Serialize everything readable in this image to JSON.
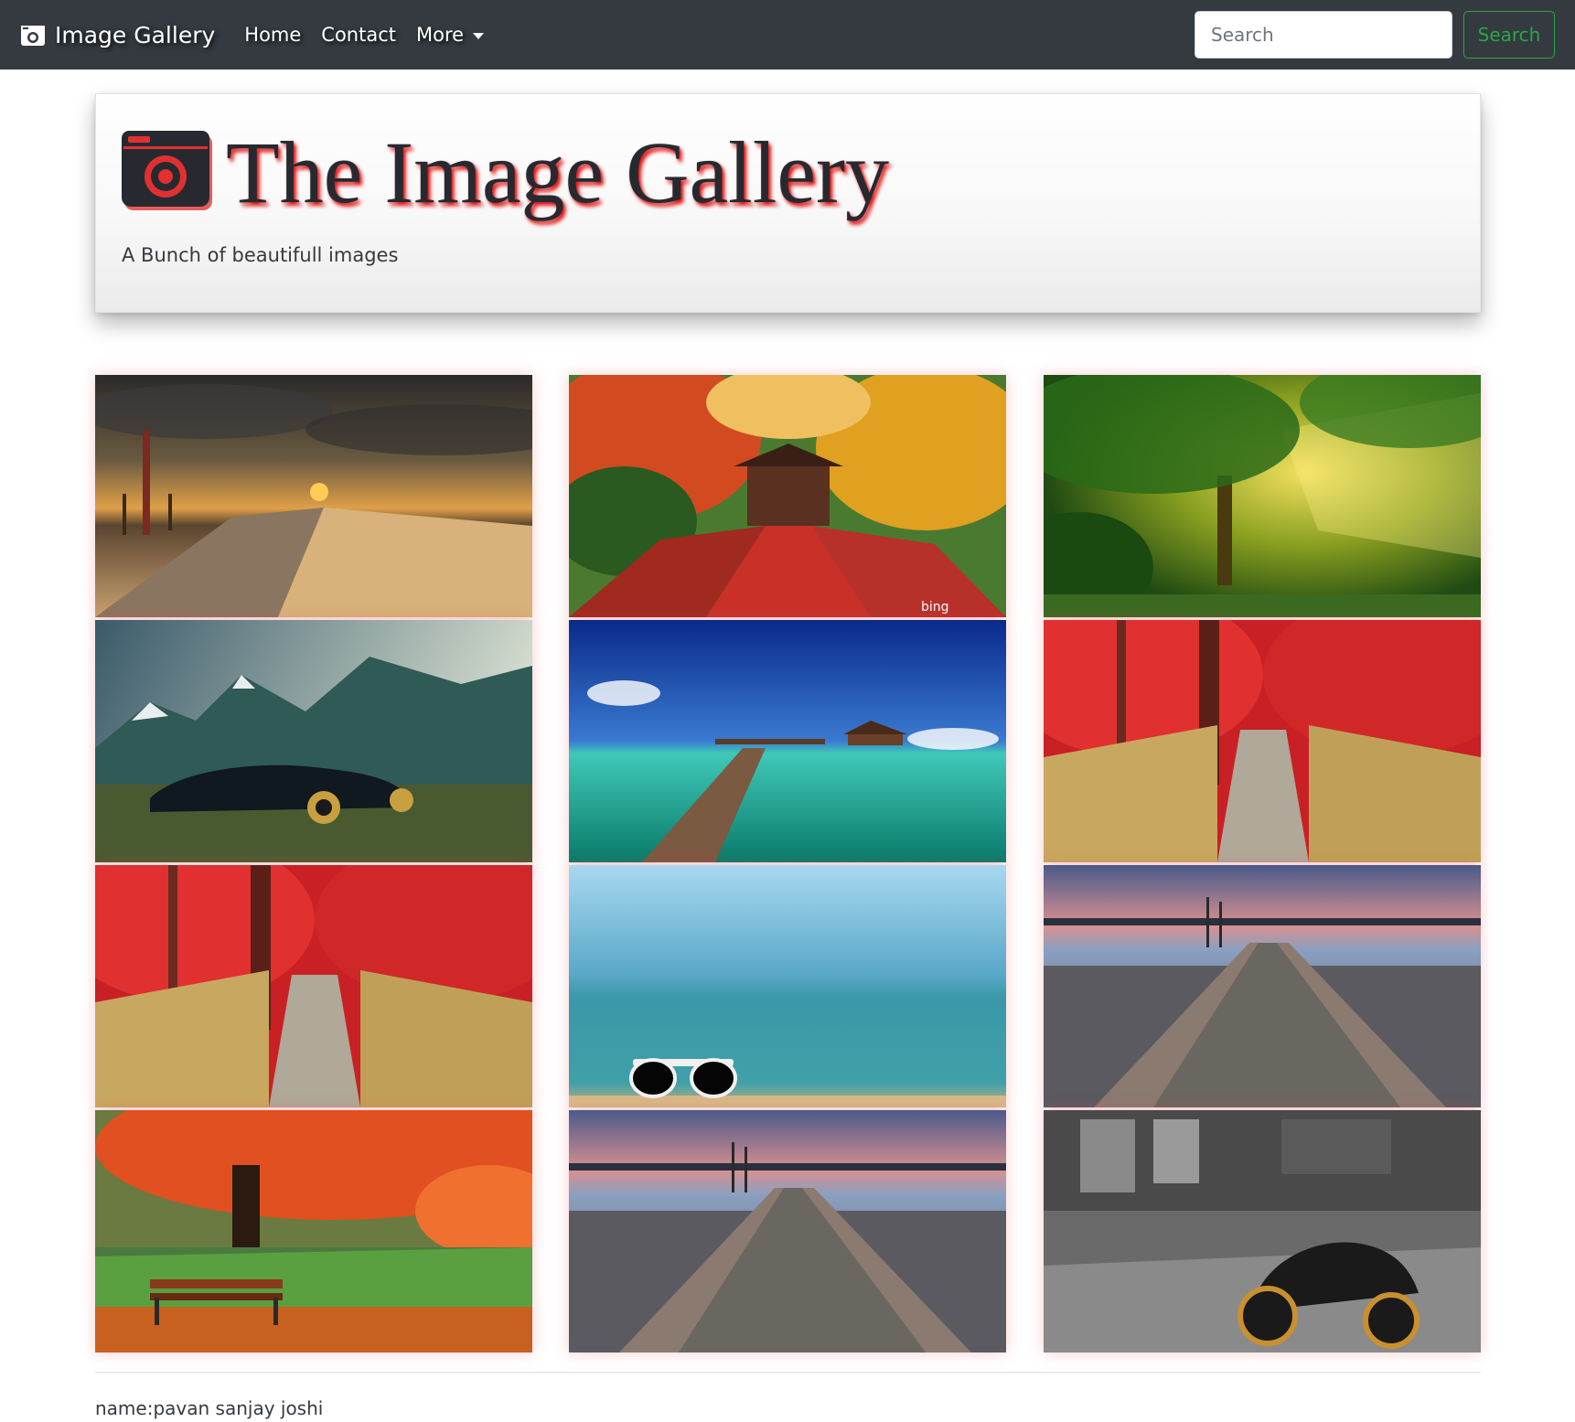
{
  "navbar": {
    "brand": "Image Gallery",
    "links": [
      {
        "label": "Home"
      },
      {
        "label": "Contact"
      },
      {
        "label": "More"
      }
    ],
    "search": {
      "placeholder": "Search",
      "value": "",
      "button": "Search"
    }
  },
  "header": {
    "title": "The Image Gallery",
    "subtitle": "A Bunch of beautifull images"
  },
  "gallery": {
    "images": [
      {
        "subject": "beach boardwalk at sunset"
      },
      {
        "subject": "autumn temple path",
        "watermark": "bing"
      },
      {
        "subject": "sunlit green forest"
      },
      {
        "subject": "black sports car with mountains"
      },
      {
        "subject": "tropical pier over turquoise water"
      },
      {
        "subject": "red forest wooden stairs"
      },
      {
        "subject": "red forest wooden stairs"
      },
      {
        "subject": "sunglasses on beach"
      },
      {
        "subject": "railway track by lake at dusk"
      },
      {
        "subject": "park bench under autumn tree"
      },
      {
        "subject": "railway track by lake at dusk"
      },
      {
        "subject": "motorcycle in abandoned factory"
      }
    ]
  },
  "footer": {
    "text": "name:pavan sanjay joshi"
  },
  "colors": {
    "navbar": "#343a40",
    "success": "#28a745",
    "title_shadow": "#e01818"
  }
}
